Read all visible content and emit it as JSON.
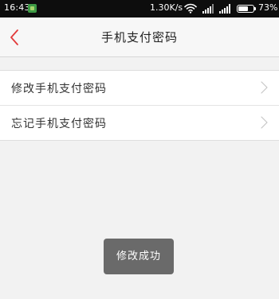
{
  "status_bar": {
    "time": "16:43",
    "network_speed": "1.30K/s",
    "battery_percent": "73%",
    "battery_level": 0.73,
    "icons": [
      "app-notification-icon",
      "wifi-icon",
      "signal-icon",
      "signal-icon",
      "battery-icon"
    ]
  },
  "nav": {
    "title": "手机支付密码",
    "back_icon": "chevron-left-icon"
  },
  "menu": {
    "items": [
      {
        "label": "修改手机支付密码",
        "icon": "chevron-right-icon"
      },
      {
        "label": "忘记手机支付密码",
        "icon": "chevron-right-icon"
      }
    ]
  },
  "toast": {
    "message": "修改成功"
  },
  "colors": {
    "accent": "#e23b3b",
    "status_bar_bg": "#0d0d0d",
    "page_bg": "#f2f2f2",
    "toast_bg": "#6a6a6a"
  }
}
